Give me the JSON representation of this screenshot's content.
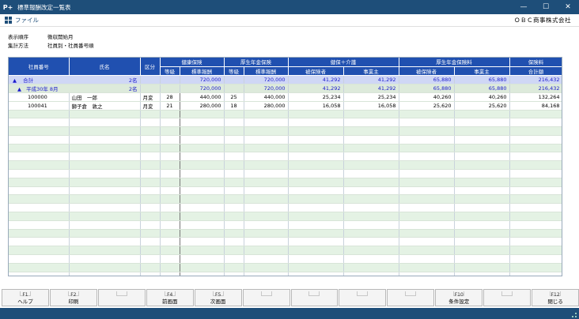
{
  "window": {
    "title": "標準報酬改定一覧表",
    "app_glyph": "P+",
    "minimize_glyph": "—",
    "maximize_glyph": "☐",
    "close_glyph": "✕"
  },
  "menubar": {
    "file_label": "ファイル",
    "company": "ＯＢＣ商事株式会社"
  },
  "info": {
    "order_label": "表示順序",
    "order_value": "徴収開始月",
    "method_label": "集計方法",
    "method_value": "社員別・社員番号順"
  },
  "table": {
    "headers": {
      "emp_no": "社員番号",
      "name": "氏名",
      "type": "区分",
      "health": "健康保険",
      "pension": "厚生年金保険",
      "care": "健保＋介護",
      "pension_fee": "厚生年金保険料",
      "total_fee": "保険料",
      "total_fee2": "合計額",
      "grade": "等級",
      "std_pay": "標準報酬",
      "insured": "被保険者",
      "employer": "事業主"
    },
    "total_row": {
      "toggle": "▲",
      "label": "合計",
      "count": "2名",
      "h_std": "720,000",
      "p_std": "720,000",
      "c_ins": "41,292",
      "c_emp": "41,292",
      "pf_ins": "65,880",
      "pf_emp": "65,880",
      "total": "216,432"
    },
    "period_row": {
      "toggle": "▲",
      "label": "平成30年 8月",
      "count": "2名",
      "h_std": "720,000",
      "p_std": "720,000",
      "c_ins": "41,292",
      "c_emp": "41,292",
      "pf_ins": "65,880",
      "pf_emp": "65,880",
      "total": "216,432"
    },
    "rows": [
      {
        "emp_no": "100000",
        "name": "山田　一郎",
        "type": "月変",
        "h_grade": "28",
        "h_std": "440,000",
        "p_grade": "25",
        "p_std": "440,000",
        "c_ins": "25,234",
        "c_emp": "25,234",
        "pf_ins": "40,260",
        "pf_emp": "40,260",
        "total": "132,264"
      },
      {
        "emp_no": "100041",
        "name": "獅子倉　敦之",
        "type": "月変",
        "h_grade": "21",
        "h_std": "280,000",
        "p_grade": "18",
        "p_std": "280,000",
        "c_ins": "16,058",
        "c_emp": "16,058",
        "pf_ins": "25,620",
        "pf_emp": "25,620",
        "total": "84,168"
      }
    ]
  },
  "fkeys": [
    {
      "key": "F1",
      "label": "ヘルプ"
    },
    {
      "key": "F2",
      "label": "印刷"
    },
    {
      "key": "",
      "label": ""
    },
    {
      "key": "F4",
      "label": "前画面"
    },
    {
      "key": "F5",
      "label": "次画面"
    },
    {
      "key": "",
      "label": ""
    },
    {
      "key": "",
      "label": ""
    },
    {
      "key": "",
      "label": ""
    },
    {
      "key": "",
      "label": ""
    },
    {
      "key": "F10",
      "label": "条件設定"
    },
    {
      "key": "",
      "label": ""
    },
    {
      "key": "F12",
      "label": "閉じる"
    }
  ]
}
